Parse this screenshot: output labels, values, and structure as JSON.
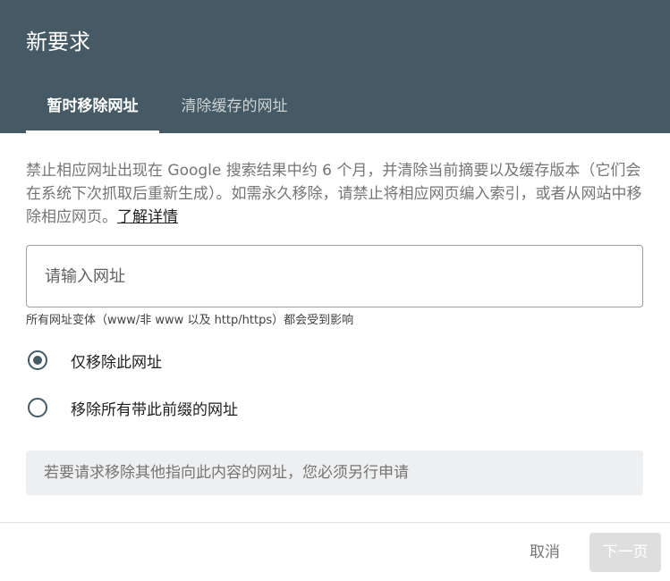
{
  "dialog": {
    "title": "新要求",
    "tabs": [
      {
        "label": "暂时移除网址",
        "active": true
      },
      {
        "label": "清除缓存的网址",
        "active": false
      }
    ],
    "description": "禁止相应网址出现在 Google 搜索结果中约 6 个月，并清除当前摘要以及缓存版本（它们会在系统下次抓取后重新生成）。如需永久移除，请禁止将相应网页编入索引，或者从网站中移除相应网页。",
    "learn_more": "了解详情",
    "url_input": {
      "placeholder": "请输入网址",
      "value": ""
    },
    "hint": "所有网址变体（www/非 www 以及 http/https）都会受到影响",
    "radio_options": [
      {
        "label": "仅移除此网址",
        "checked": true
      },
      {
        "label": "移除所有带此前缀的网址",
        "checked": false
      }
    ],
    "notice": "若要请求移除其他指向此内容的网址，您必须另行申请",
    "cancel_label": "取消",
    "next_label": "下一页"
  },
  "colors": {
    "header_bg": "#455a64",
    "notice_bg": "#eeeff0",
    "next_button_bg": "#dedede"
  }
}
